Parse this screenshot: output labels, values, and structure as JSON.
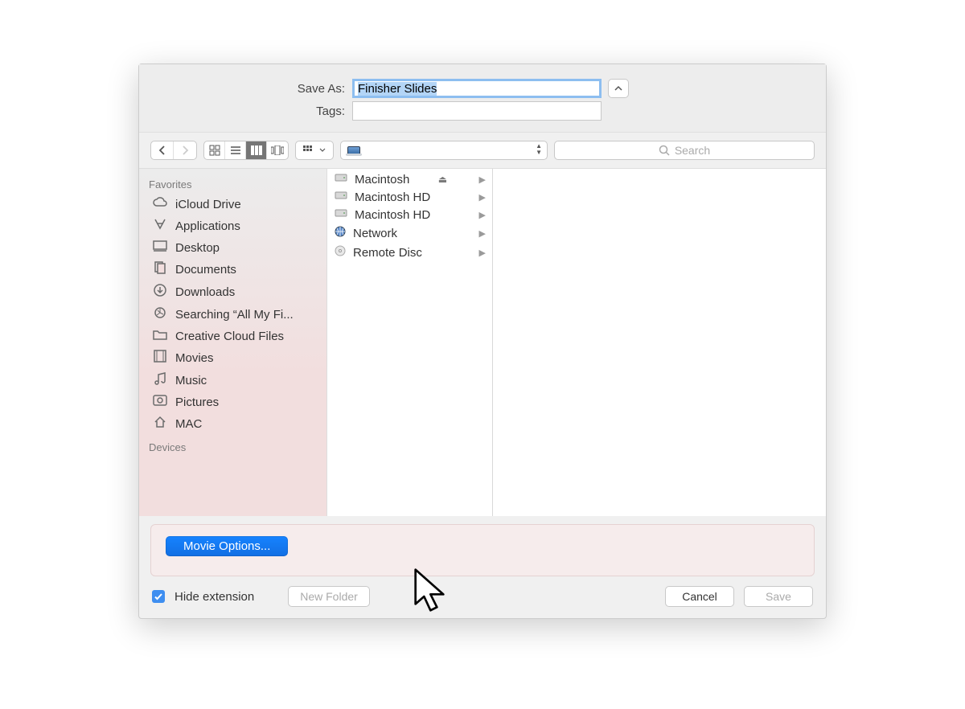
{
  "saveas_label": "Save As:",
  "saveas_value": "Finisher Slides",
  "tags_label": "Tags:",
  "search_placeholder": "Search",
  "sidebar": {
    "favorites_header": "Favorites",
    "devices_header": "Devices",
    "items": [
      {
        "icon": "cloud",
        "label": "iCloud Drive"
      },
      {
        "icon": "apps",
        "label": "Applications"
      },
      {
        "icon": "desktop",
        "label": "Desktop"
      },
      {
        "icon": "documents",
        "label": "Documents"
      },
      {
        "icon": "downloads",
        "label": "Downloads"
      },
      {
        "icon": "search",
        "label": "Searching “All My Fi..."
      },
      {
        "icon": "folder",
        "label": "Creative Cloud Files"
      },
      {
        "icon": "movies",
        "label": "Movies"
      },
      {
        "icon": "music",
        "label": "Music"
      },
      {
        "icon": "pictures",
        "label": "Pictures"
      },
      {
        "icon": "home",
        "label": "MAC"
      }
    ]
  },
  "column_items": [
    {
      "icon": "hdd",
      "label": "Macintosh",
      "eject": true
    },
    {
      "icon": "hdd",
      "label": "Macintosh HD"
    },
    {
      "icon": "hdd",
      "label": "Macintosh HD"
    },
    {
      "icon": "globe",
      "label": "Network"
    },
    {
      "icon": "disc",
      "label": "Remote Disc"
    }
  ],
  "movie_options": "Movie Options...",
  "hide_ext": "Hide extension",
  "new_folder": "New Folder",
  "cancel": "Cancel",
  "save": "Save"
}
